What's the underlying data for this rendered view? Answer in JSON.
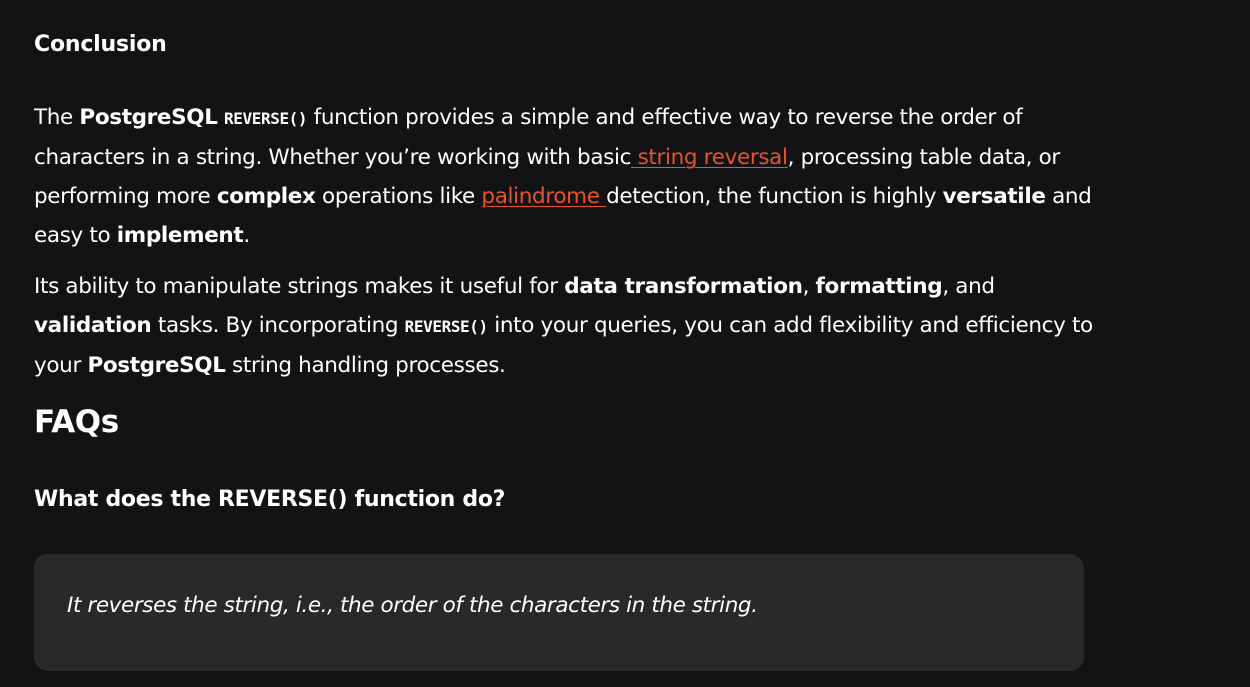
{
  "conclusion": {
    "heading": "Conclusion",
    "p1": {
      "s1": "The ",
      "b1": "PostgreSQL",
      "s2": " ",
      "code1": "REVERSE()",
      "s3": " function provides a simple and effective way to reverse the order of characters in a string. Whether you’re working with basic",
      "link1": " string reversal",
      "s4": ", processing table data, or performing more ",
      "b2": "complex",
      "s5": " operations like ",
      "link2": "palindrome ",
      "s6": "detection, the function is highly ",
      "b3": "versatile",
      "s7": " and easy to ",
      "b4": "implement",
      "s8": "."
    },
    "p2": {
      "s1": "Its ability to manipulate strings makes it useful for ",
      "b1": "data transformation",
      "s2": ", ",
      "b2": "formatting",
      "s3": ", and ",
      "b3": "validation",
      "s4": " tasks. By incorporating ",
      "code1": "REVERSE()",
      "s5": " into your queries, you can add flexibility and efficiency to your ",
      "b4": "PostgreSQL",
      "s6": " string handling processes."
    }
  },
  "faqs": {
    "heading": "FAQs",
    "items": [
      {
        "question": "What does the REVERSE() function do?",
        "answer": "It reverses the string, i.e., the order of the characters in the string."
      }
    ]
  },
  "colors": {
    "background": "#131316",
    "text": "#ffffff",
    "link": "#e5542b",
    "answer_box": "#29292b"
  }
}
